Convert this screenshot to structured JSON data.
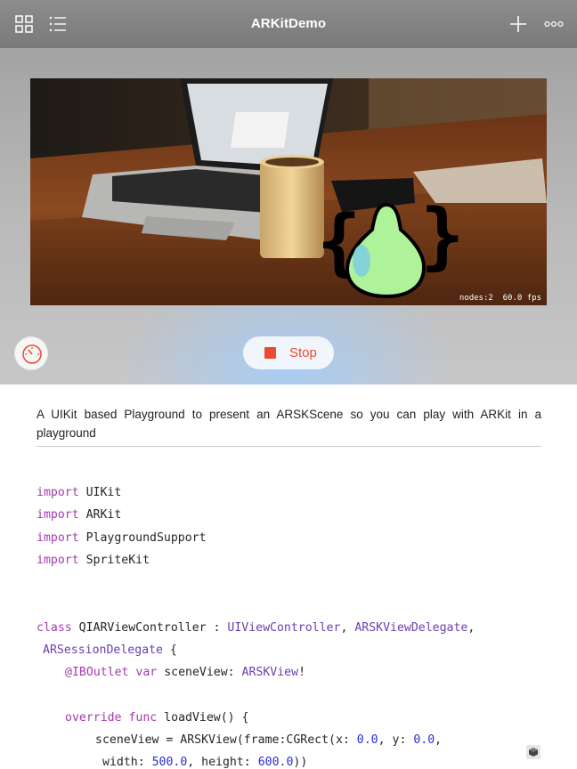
{
  "toolbar": {
    "title": "ARKitDemo",
    "icons": [
      "grid-icon",
      "list-icon",
      "plus-icon",
      "more-icon"
    ]
  },
  "live_view": {
    "stats": "nodes:2  60.0 fps",
    "stop_label": "Stop",
    "accent": "#ec4a30",
    "icons": [
      "speedometer-icon",
      "stop-icon"
    ]
  },
  "description": "A UIKit based Playground to present an ARSKScene so you can play with ARKit in a playground",
  "code": {
    "imports": [
      {
        "kw": "import",
        "name": "UIKit"
      },
      {
        "kw": "import",
        "name": "ARKit"
      },
      {
        "kw": "import",
        "name": "PlaygroundSupport"
      },
      {
        "kw": "import",
        "name": "SpriteKit"
      }
    ],
    "class_kw": "class",
    "class_name": "QIARViewController",
    "class_sep": " : ",
    "superclass": "UIViewController",
    "proto1": "ARSKViewDelegate",
    "proto2": "ARSessionDelegate",
    "iboutlet": "@IBOutlet",
    "var_kw": "var",
    "var_decl": " sceneView: ",
    "var_type": "ARSKView",
    "var_bang": "!",
    "override_kw": "override",
    "func_kw": "func",
    "func_sig": " loadView() {",
    "assign": "sceneView = ",
    "ctor": "ARSKView",
    "frame_lbl": "(frame:",
    "rect": "CGRect",
    "x_lbl": "(x: ",
    "x_val": "0.0",
    "y_lbl": ", y: ",
    "y_val": "0.0",
    "w_lbl": "width: ",
    "w_val": "500.0",
    "h_lbl": ", height: ",
    "h_val": "600.0",
    "close": "))"
  },
  "colors": {
    "keyword": "#a53bae",
    "type": "#6e3db0",
    "number": "#2b2bd0"
  }
}
